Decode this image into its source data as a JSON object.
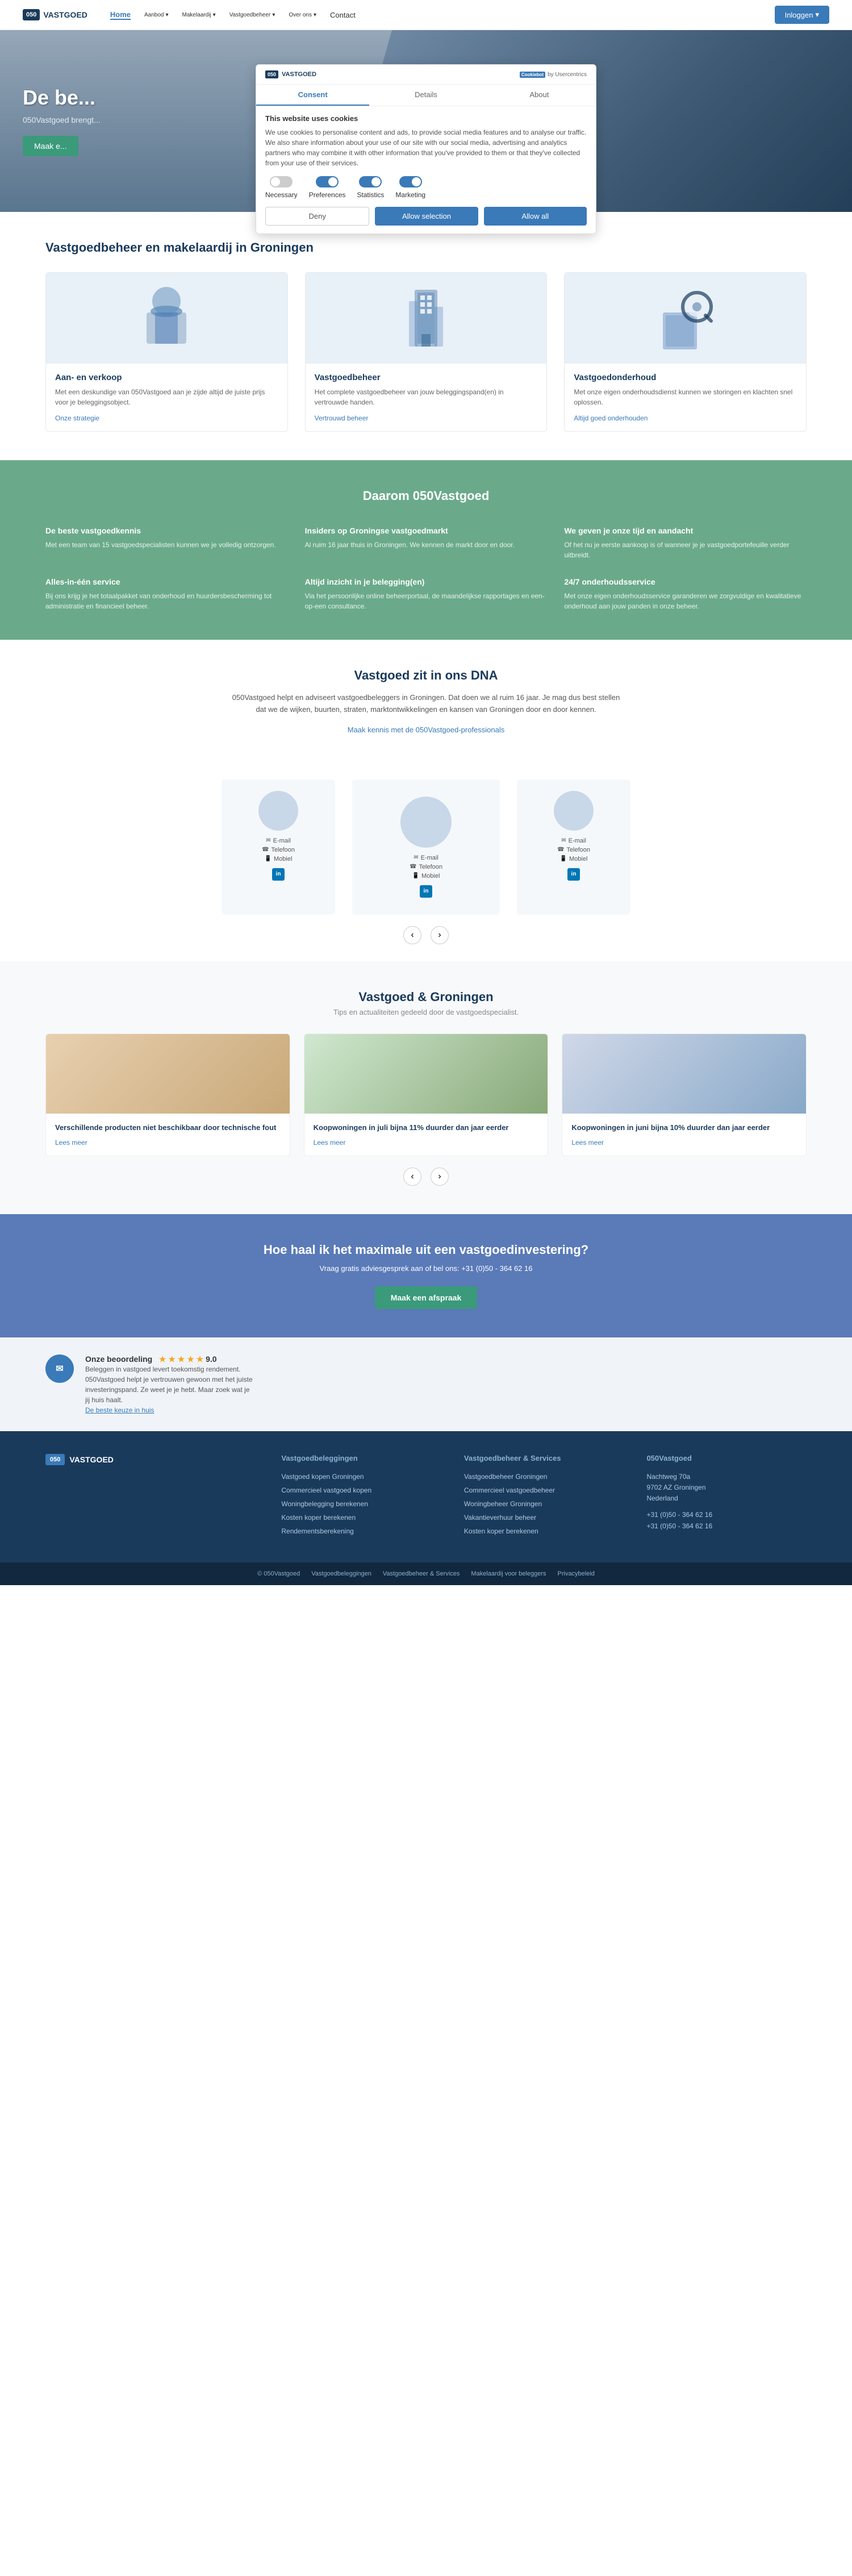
{
  "nav": {
    "logo_box": "050",
    "logo_text": "VASTGOED",
    "links": [
      {
        "label": "Home",
        "active": true,
        "dropdown": false
      },
      {
        "label": "Aanbod",
        "active": false,
        "dropdown": true
      },
      {
        "label": "Makelaardij",
        "active": false,
        "dropdown": true
      },
      {
        "label": "Vastgoedbeheer",
        "active": false,
        "dropdown": true
      },
      {
        "label": "Over ons",
        "active": false,
        "dropdown": true
      },
      {
        "label": "Contact",
        "active": false,
        "dropdown": false
      }
    ],
    "cta_label": "Inloggen"
  },
  "hero": {
    "title": "De be...",
    "subtitle": "050Vastgoed brengt...",
    "cta_label": "Maak e..."
  },
  "cookie": {
    "logo_box": "050",
    "logo_text": "VASTGOED",
    "cookiebot_label": "Cookiebot",
    "cookiebot_by": "by Usercentrics",
    "tabs": [
      {
        "label": "Consent",
        "active": true
      },
      {
        "label": "Details",
        "active": false
      },
      {
        "label": "About",
        "active": false
      }
    ],
    "title": "This website uses cookies",
    "text": "We use cookies to personalise content and ads, to provide social media features and to analyse our traffic. We also share information about your use of our site with our social media, advertising and analytics partners who may combine it with other information that you've provided to them or that they've collected from your use of their services.",
    "toggles": [
      {
        "label": "Necessary",
        "state": "off"
      },
      {
        "label": "Preferences",
        "state": "on"
      },
      {
        "label": "Statistics",
        "state": "on"
      },
      {
        "label": "Marketing",
        "state": "on"
      }
    ],
    "btn_deny": "Deny",
    "btn_allow_selection": "Allow selection",
    "btn_allow_all": "Allow all"
  },
  "services": {
    "section_title": "Vastgoedbeheer en makelaardij in Groningen",
    "cards": [
      {
        "title": "Aan- en verkoop",
        "text": "Met een deskundige van 050Vastgoed aan je zijde altijd de juiste prijs voor je beleggingsobject.",
        "link": "Onze strategie"
      },
      {
        "title": "Vastgoedbeheer",
        "text": "Het complete vastgoedbeheer van jouw beleggingspand(en) in vertrouwde handen.",
        "link": "Vertrouwd beheer"
      },
      {
        "title": "Vastgoedonderhoud",
        "text": "Met onze eigen onderhoudsdienst kunnen we storingen en klachten snel oplossen.",
        "link": "Altijd goed onderhouden"
      }
    ]
  },
  "reasons": {
    "section_title": "Daarom 050Vastgoed",
    "features": [
      {
        "title": "De beste vastgoedkennis",
        "text": "Met een team van 15 vastgoedspecialisten kunnen we je volledig ontzorgen."
      },
      {
        "title": "Insiders op Groningse vastgoedmarkt",
        "text": "Al ruim 16 jaar thuis in Groningen. We kennen de markt door en door."
      },
      {
        "title": "We geven je onze tijd en aandacht",
        "text": "Of het nu je eerste aankoop is of wanneer je je vastgoedportefeuille verder uitbreidt."
      },
      {
        "title": "Alles-in-één service",
        "text": "Bij ons krijg je het totaalpakket van onderhoud en huurdersbescherming tot administratie en financieel beheer."
      },
      {
        "title": "Altijd inzicht in je belegging(en)",
        "text": "Via het persoonlijke online beheerportaal, de maandelijkse rapportages en een-op-een consultance."
      },
      {
        "title": "24/7 onderhoudsservice",
        "text": "Met onze eigen onderhoudsservice garanderen we zorgvuldige en kwalitatieve onderhoud aan jouw panden in onze beheer."
      }
    ]
  },
  "dna": {
    "title": "Vastgoed zit in ons DNA",
    "text": "050Vastgoed helpt en adviseert vastgoedbeleggers in Groningen. Dat doen we al ruim 16 jaar. Je mag dus best stellen dat we de wijken, buurten, straten, marktontwikkelingen en kansen van Groningen door en door kennen.",
    "link": "Maak kennis met de 050Vastgoed-professionals"
  },
  "team": {
    "members": [
      {
        "name": "",
        "role": "",
        "email": "E-mail",
        "phone": "Telefoon",
        "mobile": "Mobiel",
        "linkedin": "in"
      },
      {
        "name": "",
        "role": "",
        "email": "E-mail",
        "phone": "Telefoon",
        "mobile": "Mobiel",
        "linkedin": "in"
      },
      {
        "name": "",
        "role": "",
        "email": "E-mail",
        "phone": "Telefoon",
        "mobile": "Mobiel",
        "linkedin": "in"
      }
    ],
    "prev_label": "‹",
    "next_label": "›"
  },
  "news": {
    "section_title": "Vastgoed & Groningen",
    "section_sub": "Tips en actualiteiten gedeeld door de vastgoedspecialist.",
    "articles": [
      {
        "title": "Verschillende producten niet beschikbaar door technische fout",
        "link": "Lees meer"
      },
      {
        "title": "Koopwoningen in juli bijna 11% duurder dan jaar eerder",
        "link": "Lees meer"
      },
      {
        "title": "Koopwoningen in juni bijna 10% duurder dan jaar eerder",
        "link": "Lees meer"
      }
    ]
  },
  "cta": {
    "title": "Hoe haal ik het maximale uit een vastgoedinvestering?",
    "text": "Vraag gratis adviesgesprek aan of bel ons: +31 (0)50 - 364 62 16",
    "btn_label": "Maak een afspraak"
  },
  "review": {
    "title": "Onze beoordeling",
    "stars": "★ ★ ★ ★ ★",
    "score": "9.0",
    "text": "Beleggen in vastgoed levert toekomstig rendement. 050Vastgoed helpt je vertrouwen gewoon met het juiste investeringspand. Ze weet je je hebt. Maar zoek wat je jij huis haalt.",
    "link": "De beste keuze in huis"
  },
  "footer": {
    "cols": [
      {
        "title": "Vastgoedbeleggingen",
        "links": [
          "Vastgoed kopen Groningen",
          "Commercieel vastgoed kopen",
          "Woningbelegging berekenen",
          "Kosten koper berekenen",
          "Rendementsberekening"
        ]
      },
      {
        "title": "Vastgoedbeheer & Services",
        "links": [
          "Vastgoedbeheer Groningen",
          "Commercieel vastgoedbeheer",
          "Woningbeheer Groningen",
          "Vakantieverhuur beheer",
          "Kosten koper berekenen"
        ]
      },
      {
        "title": "050Vastgoed",
        "address": "Nachtweg 70a\n9702 AZ Groningen\nNederland",
        "phone": "+31 (0)50 - 364 62 16",
        "fax": "+31 (0)50 - 364 62 16"
      }
    ],
    "bottom_links": [
      "© 050Vastgoed",
      "Vastgoedbeleggingen",
      "Vastgoedbeheer & Services",
      "Makelaardij voor beleggers",
      "Privacybeleid"
    ]
  }
}
